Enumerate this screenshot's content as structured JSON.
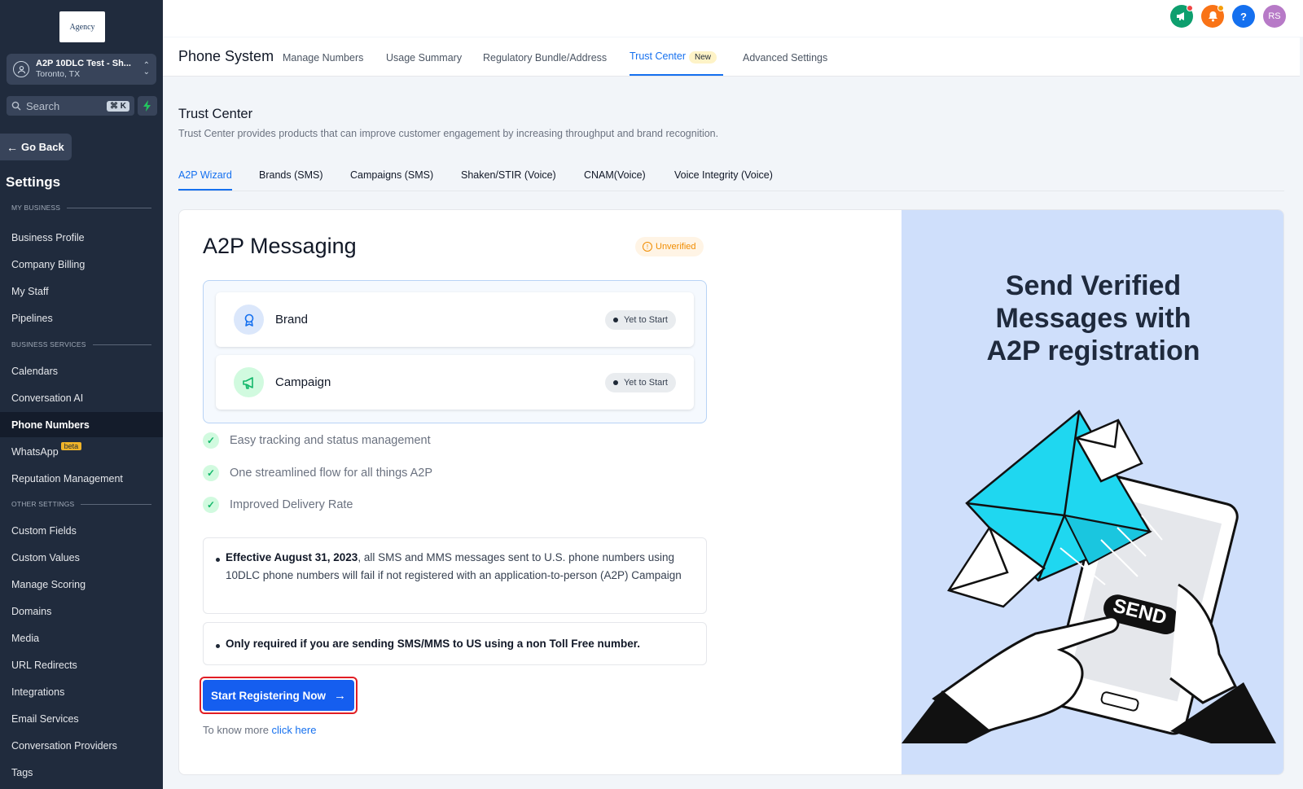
{
  "sidebar": {
    "logo_text": "Agency",
    "account": {
      "name": "A2P 10DLC Test - Sh...",
      "location": "Toronto, TX"
    },
    "search": {
      "label": "Search",
      "shortcut": "⌘ K"
    },
    "go_back": "Go Back",
    "title": "Settings",
    "sections": {
      "my_business": "MY BUSINESS",
      "business_services": "BUSINESS SERVICES",
      "other_settings": "OTHER SETTINGS"
    },
    "items": [
      "Business Profile",
      "Company Billing",
      "My Staff",
      "Pipelines",
      "Calendars",
      "Conversation AI",
      "Phone Numbers",
      "WhatsApp",
      "Reputation Management",
      "Custom Fields",
      "Custom Values",
      "Manage Scoring",
      "Domains",
      "Media",
      "URL Redirects",
      "Integrations",
      "Email Services",
      "Conversation Providers",
      "Tags"
    ],
    "beta_label": "beta",
    "active_item": "Phone Numbers"
  },
  "topbar": {
    "avatar_initials": "RS",
    "help": "?"
  },
  "subnav": {
    "title": "Phone System",
    "tabs": [
      "Manage Numbers",
      "Usage Summary",
      "Regulatory Bundle/Address",
      "Trust Center",
      "Advanced Settings"
    ],
    "active_tab": "Trust Center",
    "new_badge": "New"
  },
  "page": {
    "title": "Trust Center",
    "description": "Trust Center provides products that can improve customer engagement by increasing throughput and brand recognition.",
    "tabs": [
      "A2P Wizard",
      "Brands (SMS)",
      "Campaigns (SMS)",
      "Shaken/STIR (Voice)",
      "CNAM(Voice)",
      "Voice Integrity (Voice)"
    ],
    "active_tab": "A2P Wizard"
  },
  "card": {
    "title": "A2P Messaging",
    "status": "Unverified",
    "steps": [
      {
        "label": "Brand",
        "status": "Yet to Start"
      },
      {
        "label": "Campaign",
        "status": "Yet to Start"
      }
    ],
    "features": [
      "Easy tracking and status management",
      "One streamlined flow for all things A2P",
      "Improved Delivery Rate"
    ],
    "note1": {
      "bold": "Effective August 31, 2023",
      "text": ", all SMS and MMS messages sent to U.S. phone numbers using 10DLC phone numbers will fail if not registered with an application-to-person (A2P) Campaign"
    },
    "note2": "Only required if you are sending SMS/MMS to US using a non Toll Free number.",
    "cta": "Start Registering Now",
    "know_more": "To know more",
    "know_more_link": "click here"
  },
  "promo": {
    "line1": "Send Verified",
    "line2": "Messages with",
    "line3": "A2P registration",
    "illustration_text": "SEND"
  },
  "colors": {
    "sidebar_bg": "#202b3d",
    "accent": "#1570ef",
    "cta": "#155eef",
    "promo_bg": "#cfdffb",
    "envelope": "#1fd7f0",
    "unverified": "#f08c00"
  }
}
